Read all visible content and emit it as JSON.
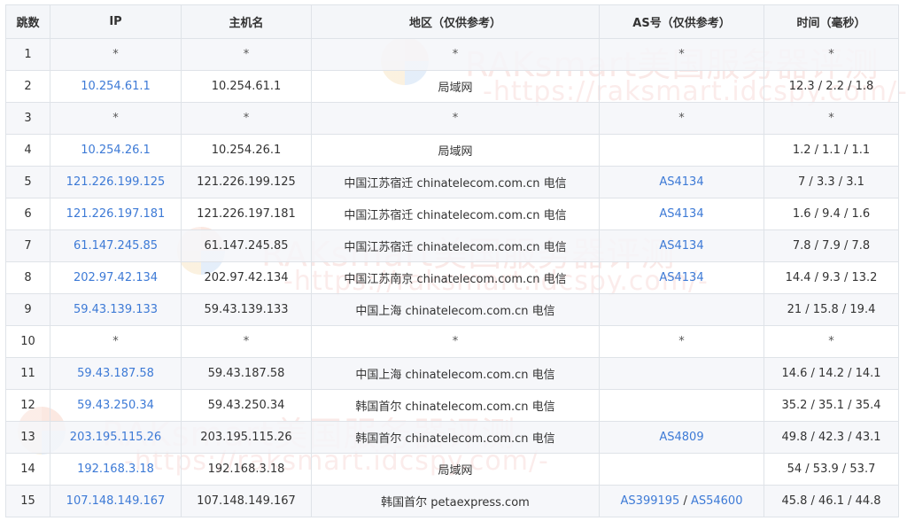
{
  "table": {
    "headers": [
      "跳数",
      "IP",
      "主机名",
      "地区（仅供参考）",
      "AS号（仅供参考）",
      "时间（毫秒）"
    ],
    "rows": [
      {
        "hop": "1",
        "ip": "*",
        "host": "*",
        "region": "*",
        "as": [
          "*"
        ],
        "time": "*"
      },
      {
        "hop": "2",
        "ip": "10.254.61.1",
        "host": "10.254.61.1",
        "region": "局域网",
        "as": [],
        "time": "12.3 / 2.2 / 1.8"
      },
      {
        "hop": "3",
        "ip": "*",
        "host": "*",
        "region": "*",
        "as": [
          "*"
        ],
        "time": "*"
      },
      {
        "hop": "4",
        "ip": "10.254.26.1",
        "host": "10.254.26.1",
        "region": "局域网",
        "as": [],
        "time": "1.2 / 1.1 / 1.1"
      },
      {
        "hop": "5",
        "ip": "121.226.199.125",
        "host": "121.226.199.125",
        "region": "中国江苏宿迁 chinatelecom.com.cn 电信",
        "as": [
          "AS4134"
        ],
        "time": "7 / 3.3 / 3.1"
      },
      {
        "hop": "6",
        "ip": "121.226.197.181",
        "host": "121.226.197.181",
        "region": "中国江苏宿迁 chinatelecom.com.cn 电信",
        "as": [
          "AS4134"
        ],
        "time": "1.6 / 9.4 / 1.6"
      },
      {
        "hop": "7",
        "ip": "61.147.245.85",
        "host": "61.147.245.85",
        "region": "中国江苏宿迁 chinatelecom.com.cn 电信",
        "as": [
          "AS4134"
        ],
        "time": "7.8 / 7.9 / 7.8"
      },
      {
        "hop": "8",
        "ip": "202.97.42.134",
        "host": "202.97.42.134",
        "region": "中国江苏南京 chinatelecom.com.cn 电信",
        "as": [
          "AS4134"
        ],
        "time": "14.4 / 9.3 / 13.2"
      },
      {
        "hop": "9",
        "ip": "59.43.139.133",
        "host": "59.43.139.133",
        "region": "中国上海 chinatelecom.com.cn 电信",
        "as": [],
        "time": "21 / 15.8 / 19.4"
      },
      {
        "hop": "10",
        "ip": "*",
        "host": "*",
        "region": "*",
        "as": [
          "*"
        ],
        "time": "*"
      },
      {
        "hop": "11",
        "ip": "59.43.187.58",
        "host": "59.43.187.58",
        "region": "中国上海 chinatelecom.com.cn 电信",
        "as": [],
        "time": "14.6 / 14.2 / 14.1"
      },
      {
        "hop": "12",
        "ip": "59.43.250.34",
        "host": "59.43.250.34",
        "region": "韩国首尔 chinatelecom.com.cn 电信",
        "as": [],
        "time": "35.2 / 35.1 / 35.4"
      },
      {
        "hop": "13",
        "ip": "203.195.115.26",
        "host": "203.195.115.26",
        "region": "韩国首尔 chinatelecom.com.cn 电信",
        "as": [
          "AS4809"
        ],
        "time": "49.8 / 42.3 / 43.1"
      },
      {
        "hop": "14",
        "ip": "192.168.3.18",
        "host": "192.168.3.18",
        "region": "局域网",
        "as": [],
        "time": "54 / 53.9 / 53.7"
      },
      {
        "hop": "15",
        "ip": "107.148.149.167",
        "host": "107.148.149.167",
        "region": "韩国首尔 petaexpress.com",
        "as": [
          "AS399195",
          "AS54600"
        ],
        "time": "45.8 / 46.1 / 44.8"
      }
    ]
  },
  "watermarks": [
    {
      "line1": "RAKsmart美国服务器评测",
      "line2": "-https://raksmart.idcspy.com/-"
    },
    {
      "line1": "RAKsmart美国服务器评测",
      "line2": "-https://raksmart.idcspy.com/-"
    },
    {
      "line1": "RAKsmart美国服务器评测",
      "line2": "-https://raksmart.idcspy.com/-"
    }
  ],
  "colors": {
    "link": "#3d7ad6",
    "header_bg": "#f4f6f9",
    "border": "#dfe3e8",
    "alt_row": "#f4f6f9"
  }
}
